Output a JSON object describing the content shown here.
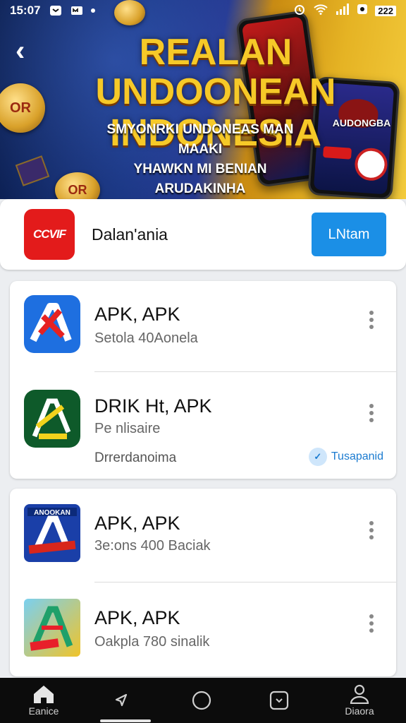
{
  "status_bar": {
    "time": "15:07",
    "battery": "222"
  },
  "hero": {
    "title_line1": "REALAN UNDOONEAN",
    "title_line2": "INDONESIA",
    "subtitle_line1": "SMYONRKI UNDONEAS MAN MAAKI",
    "subtitle_line2": "YHAWKN MI BENIAN ARUDAKINHA",
    "phone_title": "AUDONGBA",
    "coin_label": "OR"
  },
  "featured": {
    "logo_text": "CCVIF",
    "name": "Dalan'ania",
    "button_label": "LNtam"
  },
  "apps": [
    {
      "title": "APK, APK",
      "subtitle": "Setola 40Aonela",
      "icon_letter": "A",
      "icon_colors": [
        "#1e6fe0",
        "#e62222"
      ]
    },
    {
      "title": "DRIK Ht, APK",
      "subtitle": "Pe nlisaire",
      "icon_letter": "A",
      "icon_colors": [
        "#0e5a2a",
        "#f2d21c"
      ],
      "developer": "Drrerdanoima",
      "tag_label": "Tusapanid"
    },
    {
      "title": "APK, APK",
      "subtitle": "3e:ons 400 Baciak",
      "icon_letter": "A",
      "icon_colors": [
        "#1a3fa8",
        "#d8261b"
      ],
      "icon_banner": "ANOOKAN"
    },
    {
      "title": "APK, APK",
      "subtitle": "Oakpla 780 sinalik",
      "icon_letter": "A",
      "icon_colors": [
        "#f0c42a",
        "#1fa06a"
      ]
    }
  ],
  "nav": {
    "home_label": "Eanice",
    "profile_label": "Diaora"
  }
}
